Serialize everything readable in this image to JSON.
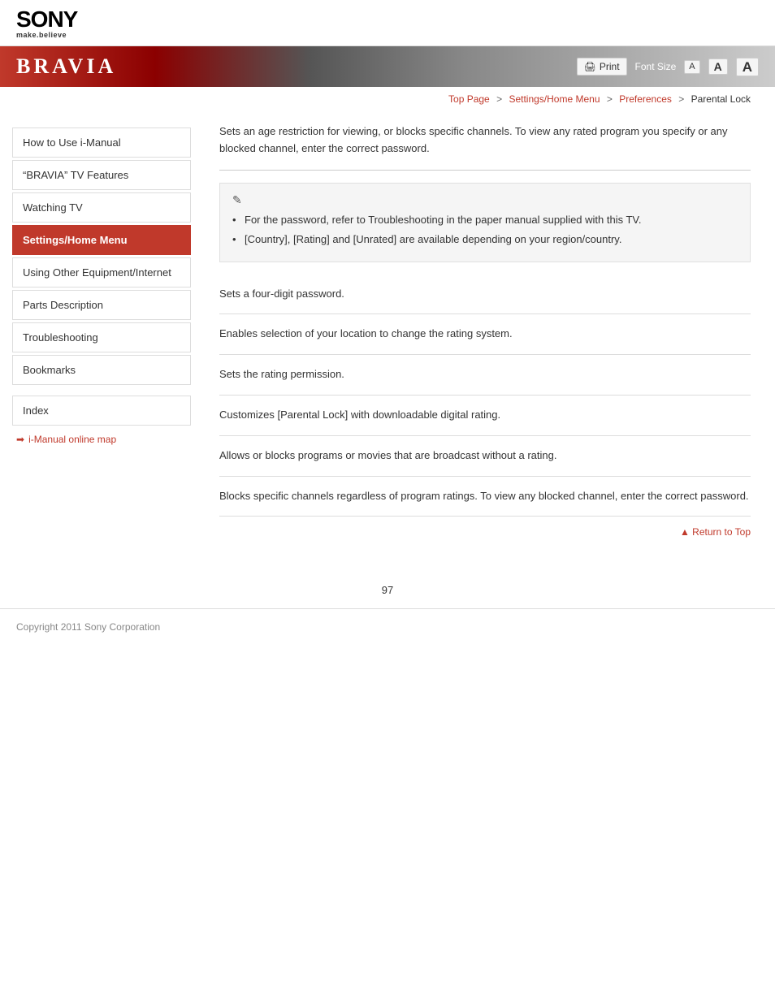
{
  "header": {
    "sony_logo": "SONY",
    "sony_tagline": "make.believe",
    "bravia_title": "BRAVIA",
    "print_label": "Print",
    "font_size_label": "Font Size",
    "font_btn_sm": "A",
    "font_btn_md": "A",
    "font_btn_lg": "A"
  },
  "breadcrumb": {
    "top_page": "Top Page",
    "sep1": ">",
    "settings_menu": "Settings/Home Menu",
    "sep2": ">",
    "preferences": "Preferences",
    "sep3": ">",
    "current": "Parental Lock"
  },
  "sidebar": {
    "items": [
      {
        "id": "how-to-use",
        "label": "How to Use i-Manual",
        "active": false
      },
      {
        "id": "bravia-features",
        "label": "“BRAVIA” TV Features",
        "active": false
      },
      {
        "id": "watching-tv",
        "label": "Watching TV",
        "active": false
      },
      {
        "id": "settings-home",
        "label": "Settings/Home Menu",
        "active": true
      },
      {
        "id": "using-other",
        "label": "Using Other Equipment/Internet",
        "active": false
      },
      {
        "id": "parts-description",
        "label": "Parts Description",
        "active": false
      },
      {
        "id": "troubleshooting",
        "label": "Troubleshooting",
        "active": false
      },
      {
        "id": "bookmarks",
        "label": "Bookmarks",
        "active": false
      }
    ],
    "index_label": "Index",
    "imanual_link": "i-Manual online map"
  },
  "content": {
    "intro_text": "Sets an age restriction for viewing, or blocks specific channels. To view any rated program you specify or any blocked channel, enter the correct password.",
    "note_icon": "✎",
    "notes": [
      "For the password, refer to Troubleshooting in the paper manual supplied with this TV.",
      "[Country], [Rating] and [Unrated] are available depending on your region/country."
    ],
    "rows": [
      "Sets a four-digit password.",
      "Enables selection of your location to change the rating system.",
      "Sets the rating permission.",
      "Customizes [Parental Lock] with downloadable digital rating.",
      "Allows or blocks programs or movies that are broadcast without a rating.",
      "Blocks specific channels regardless of program ratings. To view any blocked channel, enter the correct password."
    ],
    "return_top": "Return to Top"
  },
  "footer": {
    "copyright": "Copyright 2011 Sony Corporation",
    "page_number": "97"
  }
}
